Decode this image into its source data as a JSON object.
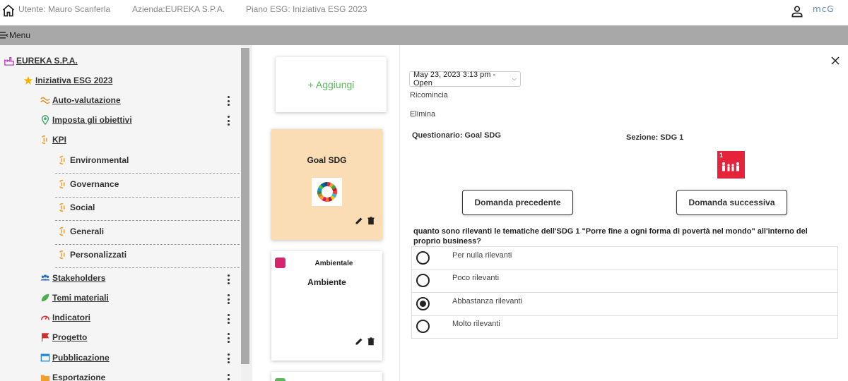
{
  "header": {
    "user": "Utente: Mauro Scanferla",
    "company": "Azienda:EUREKA S.P.A.",
    "plan": "Piano ESG: Iniziativa ESG 2023",
    "brand": "MCG"
  },
  "menubar": {
    "label": "Menu"
  },
  "sidebar": {
    "company": "EUREKA S.P.A.",
    "initiative": "Iniziativa ESG 2023",
    "items": [
      {
        "label": "Auto-valutazione",
        "icon": "wave-icon",
        "color": "#e8892b"
      },
      {
        "label": "Imposta gli obiettivi",
        "icon": "target-pin-icon",
        "color": "#3aa36a"
      },
      {
        "label": "KPI",
        "icon": "kpi-icon",
        "color": "#f0a030"
      }
    ],
    "kpi_sub": [
      "Environmental",
      "Governance",
      "Social",
      "Generali",
      "Personalizzati"
    ],
    "items2": [
      {
        "label": "Stakeholders",
        "icon": "people-icon",
        "color": "#2f6fb7"
      },
      {
        "label": "Temi materiali",
        "icon": "leaf-icon",
        "color": "#4caf50"
      },
      {
        "label": "Indicatori",
        "icon": "gauge-icon",
        "color": "#d32f2f"
      },
      {
        "label": "Progetto",
        "icon": "flag-icon",
        "color": "#d32f2f"
      },
      {
        "label": "Pubblicazione",
        "icon": "window-icon",
        "color": "#1e88e5"
      },
      {
        "label": "Esportazione",
        "icon": "folder-icon",
        "color": "#f0a030"
      }
    ]
  },
  "cards": {
    "add_label": "+ Aggiungi",
    "goal_title": "Goal SDG",
    "amb_category": "Ambientale",
    "amb_title": "Ambiente"
  },
  "main": {
    "session": "May 23, 2023 3:13 pm - Open",
    "restart": "Ricomincia",
    "delete": "Elimina",
    "questionnaire": "Questionario: Goal SDG",
    "section": "Sezione: SDG 1",
    "sdg_number": "1",
    "prev_button": "Domanda precedente",
    "next_button": "Domanda successiva",
    "question": "quanto sono rilevanti le tematiche dell'SDG 1 \"Porre fine a ogni forma di povertà nel mondo\" all'interno del proprio business?",
    "options": [
      "Per nulla rilevanti",
      "Poco rilevanti",
      "Abbastanza rilevanti",
      "Molto rilevanti"
    ],
    "selected_option": 2
  }
}
